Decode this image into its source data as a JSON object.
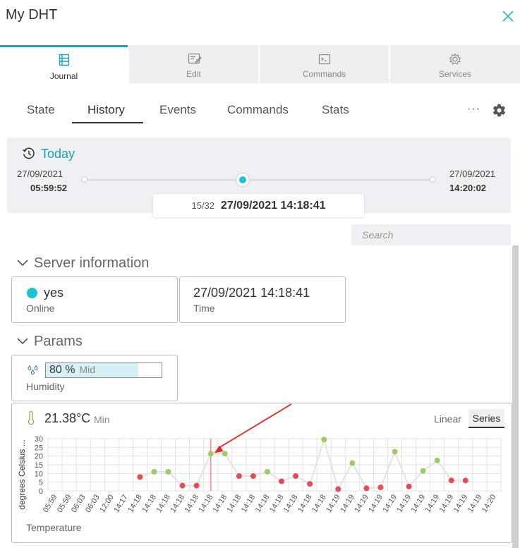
{
  "window": {
    "title": "My DHT"
  },
  "top_tabs": [
    {
      "label": "Journal",
      "icon": "journal-icon"
    },
    {
      "label": "Edit",
      "icon": "edit-icon"
    },
    {
      "label": "Commands",
      "icon": "terminal-icon"
    },
    {
      "label": "Services",
      "icon": "services-gear-icon"
    }
  ],
  "sub_tabs": [
    {
      "label": "State"
    },
    {
      "label": "History"
    },
    {
      "label": "Events"
    },
    {
      "label": "Commands"
    },
    {
      "label": "Stats"
    }
  ],
  "more_label": "···",
  "timeline": {
    "range_label": "Today",
    "start_date": "27/09/2021",
    "start_time": "05:59:52",
    "end_date": "27/09/2021",
    "end_time": "14:20:02",
    "position_fraction": 0.455,
    "current_index": "15/32",
    "current_datetime": "27/09/2021 14:18:41"
  },
  "search": {
    "placeholder": "Search"
  },
  "server_info": {
    "title": "Server information",
    "online_value": "yes",
    "online_label": "Online",
    "time_value": "27/09/2021 14:18:41",
    "time_label": "Time"
  },
  "params": {
    "title": "Params",
    "humidity_value": "80 %",
    "humidity_level": "Mid",
    "humidity_label": "Humidity",
    "humidity_fraction": 0.8
  },
  "temperature": {
    "value": "21.38°C",
    "level": "Min",
    "label": "Temperature",
    "mode_linear": "Linear",
    "mode_series": "Series"
  },
  "colors": {
    "accent": "#1aa3b3",
    "online": "#1cc3d6",
    "point_green": "#9ccc65",
    "point_red": "#e84c52",
    "cursor_line": "#f28b8b",
    "arrow": "#e8261e"
  },
  "chart_data": {
    "type": "line",
    "ylabel": "degrees Celsius ...",
    "xlabel": "",
    "ylim": [
      0,
      30
    ],
    "yticks": [
      "0",
      "5",
      "10",
      "15",
      "20",
      "25",
      "30"
    ],
    "x": [
      "05:59",
      "05:59",
      "06:03",
      "06:03",
      "12:00",
      "14:17",
      "14:18",
      "14:18",
      "14:18",
      "14:18",
      "14:18",
      "14:18",
      "14:18",
      "14:18",
      "14:18",
      "14:18",
      "14:18",
      "14:18",
      "14:18",
      "14:18",
      "14:19",
      "14:19",
      "14:19",
      "14:19",
      "14:19",
      "14:19",
      "14:19",
      "14:19",
      "14:19",
      "14:19",
      "14:19",
      "14:20"
    ],
    "values": [
      null,
      null,
      null,
      null,
      null,
      null,
      8,
      11,
      11,
      3,
      3,
      21.4,
      21.4,
      8.5,
      8.5,
      11,
      5.5,
      8.5,
      4,
      29.5,
      1,
      16,
      1.5,
      2,
      22.5,
      2.5,
      11.5,
      17.5,
      6,
      6
    ],
    "point_status": [
      "",
      "",
      "",
      "",
      "",
      "",
      "red",
      "green",
      "green",
      "red",
      "red",
      "green",
      "green",
      "red",
      "red",
      "green",
      "red",
      "red",
      "red",
      "green",
      "red",
      "green",
      "red",
      "red",
      "green",
      "red",
      "green",
      "green",
      "red",
      "red"
    ],
    "current_index": 11,
    "grid": true
  }
}
